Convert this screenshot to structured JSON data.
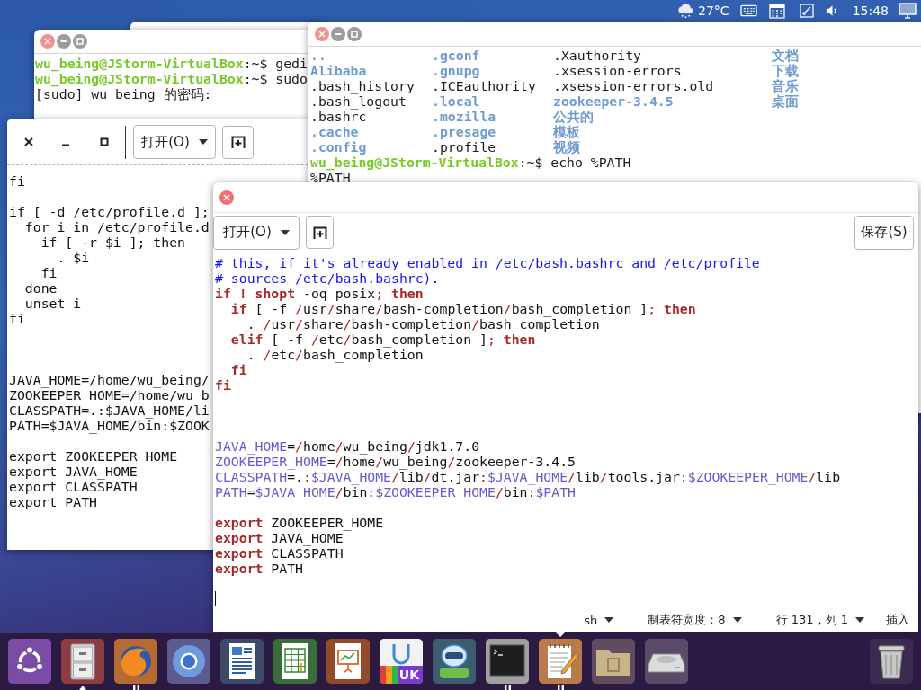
{
  "top_panel": {
    "temperature": "27°C",
    "clock": "15:48"
  },
  "terminal_1": {
    "lines": [
      {
        "kind": "prompt",
        "prompt": "wu_being@JStorm-VirtualBox",
        "text": ":~$ gedi"
      },
      {
        "kind": "prompt",
        "prompt": "wu_being@JStorm-VirtualBox",
        "text": ":~$ sudo"
      },
      {
        "kind": "output",
        "text": "[sudo] wu_being 的密码:"
      }
    ]
  },
  "editor_left": {
    "open_button": "打开(O)",
    "lines": [
      {
        "kind": "text",
        "text": "fi"
      },
      {
        "kind": "blank"
      },
      {
        "kind": "text",
        "text": "if [ -d /etc/profile.d ];"
      },
      {
        "kind": "text",
        "text": "  for i in /etc/profile.d"
      },
      {
        "kind": "text",
        "text": "    if [ -r $i ]; then"
      },
      {
        "kind": "text",
        "text": "      . $i"
      },
      {
        "kind": "text",
        "text": "    fi"
      },
      {
        "kind": "text",
        "text": "  done"
      },
      {
        "kind": "text",
        "text": "  unset i"
      },
      {
        "kind": "text",
        "text": "fi"
      },
      {
        "kind": "blank"
      },
      {
        "kind": "blank"
      },
      {
        "kind": "blank"
      },
      {
        "kind": "text",
        "text": "JAVA_HOME=/home/wu_being/"
      },
      {
        "kind": "text",
        "text": "ZOOKEEPER_HOME=/home/wu_b"
      },
      {
        "kind": "text",
        "text": "CLASSPATH=.:$JAVA_HOME/li"
      },
      {
        "kind": "text",
        "text": "PATH=$JAVA_HOME/bin:$ZOOK"
      },
      {
        "kind": "blank"
      },
      {
        "kind": "text",
        "text": "export ZOOKEEPER_HOME"
      },
      {
        "kind": "text",
        "text": "export JAVA_HOME"
      },
      {
        "kind": "text",
        "text": "export CLASSPATH"
      },
      {
        "kind": "text",
        "text": "export PATH"
      }
    ]
  },
  "terminal_2": {
    "listing": [
      [
        {
          "kind": "dir",
          "text": ".."
        },
        {
          "kind": "dir",
          "text": ".gconf"
        },
        {
          "kind": "file",
          "text": ".Xauthority"
        },
        {
          "kind": "dir",
          "text": "文档"
        }
      ],
      [
        {
          "kind": "dir",
          "text": "Alibaba"
        },
        {
          "kind": "dir",
          "text": ".gnupg"
        },
        {
          "kind": "file",
          "text": ".xsession-errors"
        },
        {
          "kind": "dir",
          "text": "下载"
        }
      ],
      [
        {
          "kind": "file",
          "text": ".bash_history"
        },
        {
          "kind": "file",
          "text": ".ICEauthority"
        },
        {
          "kind": "file",
          "text": ".xsession-errors.old"
        },
        {
          "kind": "dir",
          "text": "音乐"
        }
      ],
      [
        {
          "kind": "file",
          "text": ".bash_logout"
        },
        {
          "kind": "dir",
          "text": ".local"
        },
        {
          "kind": "dir",
          "text": "zookeeper-3.4.5"
        },
        {
          "kind": "dir",
          "text": "桌面"
        }
      ],
      [
        {
          "kind": "file",
          "text": ".bashrc"
        },
        {
          "kind": "dir",
          "text": ".mozilla"
        },
        {
          "kind": "dir",
          "text": "公共的"
        }
      ],
      [
        {
          "kind": "dir",
          "text": ".cache"
        },
        {
          "kind": "dir",
          "text": ".presage"
        },
        {
          "kind": "dir",
          "text": "模板"
        }
      ],
      [
        {
          "kind": "dir",
          "text": ".config"
        },
        {
          "kind": "file",
          "text": ".profile"
        },
        {
          "kind": "dir",
          "text": "视频"
        }
      ]
    ],
    "lines": [
      {
        "kind": "prompt",
        "prompt": "wu_being@JStorm-VirtualBox",
        "text": ":~$ echo %PATH"
      },
      {
        "kind": "output",
        "text": "%PATH"
      }
    ]
  },
  "editor_right": {
    "open_button": "打开(O)",
    "save_button": "保存(S)",
    "lines": [
      {
        "kind": "code",
        "segments": [
          {
            "kind": "comment",
            "text": "# this, if it's already enabled in /etc/bash.bashrc and /etc/profile"
          }
        ]
      },
      {
        "kind": "code",
        "segments": [
          {
            "kind": "comment",
            "text": "# sources /etc/bash.bashrc)."
          }
        ]
      },
      {
        "kind": "code",
        "segments": [
          {
            "kind": "keyword",
            "text": "if ! shopt"
          },
          {
            "kind": "plain",
            "text": " -oq posix"
          },
          {
            "kind": "op",
            "text": "; "
          },
          {
            "kind": "keyword",
            "text": "then"
          }
        ]
      },
      {
        "kind": "code",
        "segments": [
          {
            "kind": "keyword",
            "text": "  if"
          },
          {
            "kind": "plain",
            "text": " [ -f "
          },
          {
            "kind": "op",
            "text": "/"
          },
          {
            "kind": "plain",
            "text": "usr"
          },
          {
            "kind": "op",
            "text": "/"
          },
          {
            "kind": "plain",
            "text": "share"
          },
          {
            "kind": "op",
            "text": "/"
          },
          {
            "kind": "plain",
            "text": "bash-completion"
          },
          {
            "kind": "op",
            "text": "/"
          },
          {
            "kind": "plain",
            "text": "bash_completion ]"
          },
          {
            "kind": "op",
            "text": "; "
          },
          {
            "kind": "keyword",
            "text": "then"
          }
        ]
      },
      {
        "kind": "code",
        "segments": [
          {
            "kind": "plain",
            "text": "    . "
          },
          {
            "kind": "op",
            "text": "/"
          },
          {
            "kind": "plain",
            "text": "usr"
          },
          {
            "kind": "op",
            "text": "/"
          },
          {
            "kind": "plain",
            "text": "share"
          },
          {
            "kind": "op",
            "text": "/"
          },
          {
            "kind": "plain",
            "text": "bash-completion"
          },
          {
            "kind": "op",
            "text": "/"
          },
          {
            "kind": "plain",
            "text": "bash_completion"
          }
        ]
      },
      {
        "kind": "code",
        "segments": [
          {
            "kind": "keyword",
            "text": "  elif"
          },
          {
            "kind": "plain",
            "text": " [ -f "
          },
          {
            "kind": "op",
            "text": "/"
          },
          {
            "kind": "plain",
            "text": "etc"
          },
          {
            "kind": "op",
            "text": "/"
          },
          {
            "kind": "plain",
            "text": "bash_completion ]"
          },
          {
            "kind": "op",
            "text": "; "
          },
          {
            "kind": "keyword",
            "text": "then"
          }
        ]
      },
      {
        "kind": "code",
        "segments": [
          {
            "kind": "plain",
            "text": "    . "
          },
          {
            "kind": "op",
            "text": "/"
          },
          {
            "kind": "plain",
            "text": "etc"
          },
          {
            "kind": "op",
            "text": "/"
          },
          {
            "kind": "plain",
            "text": "bash_completion"
          }
        ]
      },
      {
        "kind": "code",
        "segments": [
          {
            "kind": "keyword",
            "text": "  fi"
          }
        ]
      },
      {
        "kind": "code",
        "segments": [
          {
            "kind": "keyword",
            "text": "fi"
          }
        ]
      },
      {
        "kind": "blank"
      },
      {
        "kind": "blank"
      },
      {
        "kind": "blank"
      },
      {
        "kind": "code",
        "segments": [
          {
            "kind": "var",
            "text": "JAVA_HOME"
          },
          {
            "kind": "plain",
            "text": "="
          },
          {
            "kind": "op",
            "text": "/"
          },
          {
            "kind": "plain",
            "text": "home"
          },
          {
            "kind": "op",
            "text": "/"
          },
          {
            "kind": "plain",
            "text": "wu_being"
          },
          {
            "kind": "op",
            "text": "/"
          },
          {
            "kind": "plain",
            "text": "jdk1.7.0"
          }
        ]
      },
      {
        "kind": "code",
        "segments": [
          {
            "kind": "var",
            "text": "ZOOKEEPER_HOME"
          },
          {
            "kind": "plain",
            "text": "="
          },
          {
            "kind": "op",
            "text": "/"
          },
          {
            "kind": "plain",
            "text": "home"
          },
          {
            "kind": "op",
            "text": "/"
          },
          {
            "kind": "plain",
            "text": "wu_being"
          },
          {
            "kind": "op",
            "text": "/"
          },
          {
            "kind": "plain",
            "text": "zookeeper-3.4.5"
          }
        ]
      },
      {
        "kind": "code",
        "segments": [
          {
            "kind": "var",
            "text": "CLASSPATH"
          },
          {
            "kind": "plain",
            "text": "=."
          },
          {
            "kind": "op",
            "text": ":"
          },
          {
            "kind": "var",
            "text": "$JAVA_HOME"
          },
          {
            "kind": "op",
            "text": "/"
          },
          {
            "kind": "plain",
            "text": "lib"
          },
          {
            "kind": "op",
            "text": "/"
          },
          {
            "kind": "plain",
            "text": "dt.jar"
          },
          {
            "kind": "op",
            "text": ":"
          },
          {
            "kind": "var",
            "text": "$JAVA_HOME"
          },
          {
            "kind": "op",
            "text": "/"
          },
          {
            "kind": "plain",
            "text": "lib"
          },
          {
            "kind": "op",
            "text": "/"
          },
          {
            "kind": "plain",
            "text": "tools.jar"
          },
          {
            "kind": "op",
            "text": ":"
          },
          {
            "kind": "var",
            "text": "$ZOOKEEPER_HOME"
          },
          {
            "kind": "op",
            "text": "/"
          },
          {
            "kind": "plain",
            "text": "lib"
          }
        ]
      },
      {
        "kind": "code",
        "segments": [
          {
            "kind": "var",
            "text": "PATH"
          },
          {
            "kind": "plain",
            "text": "="
          },
          {
            "kind": "var",
            "text": "$JAVA_HOME"
          },
          {
            "kind": "op",
            "text": "/"
          },
          {
            "kind": "plain",
            "text": "bin"
          },
          {
            "kind": "op",
            "text": ":"
          },
          {
            "kind": "var",
            "text": "$ZOOKEEPER_HOME"
          },
          {
            "kind": "op",
            "text": "/"
          },
          {
            "kind": "plain",
            "text": "bin"
          },
          {
            "kind": "op",
            "text": ":"
          },
          {
            "kind": "var",
            "text": "$PATH"
          }
        ]
      },
      {
        "kind": "blank"
      },
      {
        "kind": "code",
        "segments": [
          {
            "kind": "keyword",
            "text": "export"
          },
          {
            "kind": "plain",
            "text": " ZOOKEEPER_HOME"
          }
        ]
      },
      {
        "kind": "code",
        "segments": [
          {
            "kind": "keyword",
            "text": "export"
          },
          {
            "kind": "plain",
            "text": " JAVA_HOME"
          }
        ]
      },
      {
        "kind": "code",
        "segments": [
          {
            "kind": "keyword",
            "text": "export"
          },
          {
            "kind": "plain",
            "text": " CLASSPATH"
          }
        ]
      },
      {
        "kind": "code",
        "segments": [
          {
            "kind": "keyword",
            "text": "export"
          },
          {
            "kind": "plain",
            "text": " PATH"
          }
        ]
      },
      {
        "kind": "blank"
      },
      {
        "kind": "cursor"
      }
    ],
    "status_bar": [
      {
        "kind": "dropdown",
        "label": "sh"
      },
      {
        "kind": "dropdown",
        "label": "制表符宽度：8"
      },
      {
        "kind": "dropdown",
        "label": "行 131，列 1"
      },
      {
        "kind": "text",
        "label": "插入"
      }
    ]
  },
  "dock": {
    "items": [
      {
        "kind": "logo",
        "running": false,
        "multiple_windows": false,
        "focused": false
      },
      {
        "kind": "cabinet",
        "running": true,
        "multiple_windows": false,
        "focused": false
      },
      {
        "kind": "globe",
        "running": true,
        "multiple_windows": true,
        "focused": false
      },
      {
        "kind": "ring",
        "running": false,
        "multiple_windows": false,
        "focused": false
      },
      {
        "kind": "document",
        "running": false,
        "multiple_windows": false,
        "focused": false
      },
      {
        "kind": "spreadsheet",
        "running": false,
        "multiple_windows": false,
        "focused": false
      },
      {
        "kind": "presentation",
        "running": false,
        "multiple_windows": false,
        "focused": false
      },
      {
        "kind": "lettered",
        "label": "UK",
        "running": false,
        "multiple_windows": false,
        "focused": false
      },
      {
        "kind": "robot",
        "running": false,
        "multiple_windows": false,
        "focused": false
      },
      {
        "kind": "terminal",
        "running": true,
        "multiple_windows": true,
        "focused": false
      },
      {
        "kind": "notepad",
        "running": true,
        "multiple_windows": true,
        "focused": true
      },
      {
        "kind": "folder",
        "running": false,
        "multiple_windows": false,
        "focused": false
      },
      {
        "kind": "drive",
        "running": false,
        "multiple_windows": false,
        "focused": false
      },
      {
        "kind": "trash",
        "running": false,
        "multiple_windows": false,
        "focused": false
      }
    ]
  }
}
